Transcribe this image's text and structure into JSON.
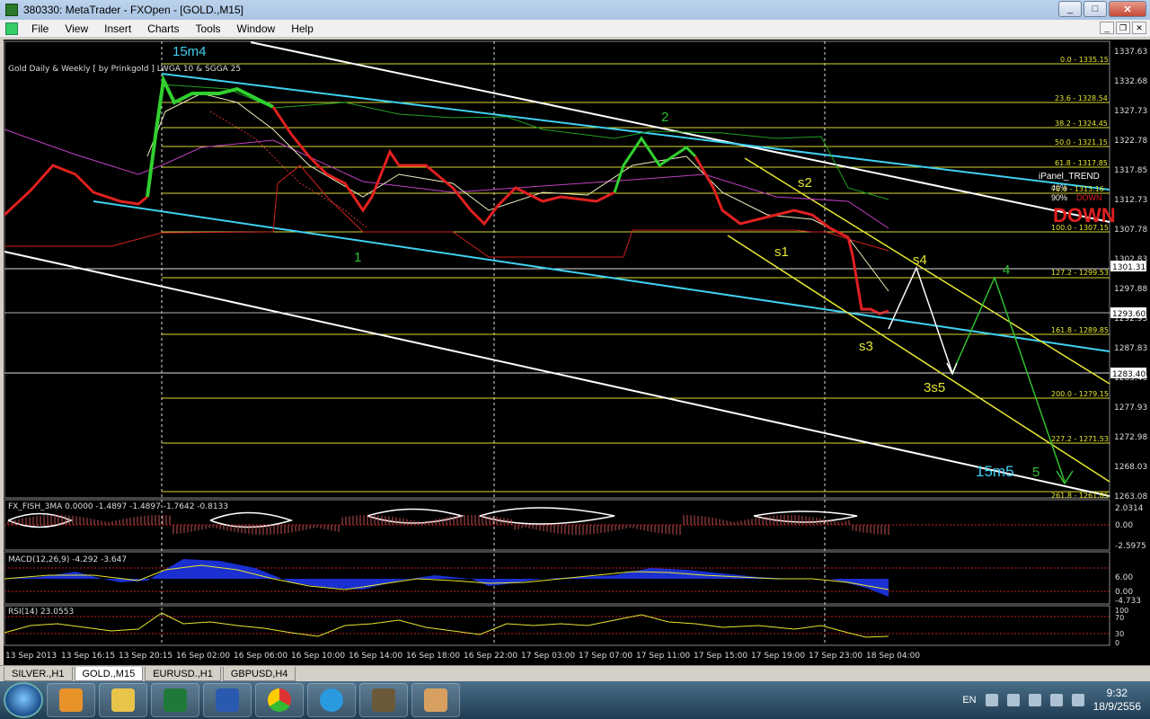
{
  "window": {
    "title": "380330: MetaTrader - FXOpen - [GOLD.,M15]",
    "win_minimize": "_",
    "win_maximize": "□",
    "win_close": "✕"
  },
  "menu": [
    "File",
    "View",
    "Insert",
    "Charts",
    "Tools",
    "Window",
    "Help"
  ],
  "chart": {
    "header": "Gold Daily & Weekly [ by Prinkgold ]  LWGA 10 &  SGGA 25",
    "price_scale": [
      "1337.63",
      "1332.68",
      "1327.73",
      "1322.78",
      "1317.85",
      "1312.73",
      "1307.78",
      "1302.83",
      "1297.88",
      "1292.93",
      "1287.83",
      "1283.40",
      "1277.93",
      "1272.98",
      "1268.03",
      "1263.08"
    ],
    "current_price": "1293.60",
    "tag_upper": "1301.31",
    "tag_lower": "1283.40",
    "fib_levels": [
      "0.0 - 1335.15",
      "23.6 - 1328.54",
      "38.2 - 1324.45",
      "50.0 - 1321.15",
      "61.8 - 1317.85",
      "78.6 - 1313.16",
      "100.0 - 1307.15",
      "127.2 - 1299.53",
      "161.8 - 1289.85",
      "200.0 - 1279.15",
      "227.2 - 1271.53",
      "261.8 - 1261.85"
    ],
    "wave_labels": {
      "w15m4": "15m4",
      "w1": "1",
      "w2": "2",
      "s1": "s1",
      "s2": "s2",
      "s3": "s3",
      "s4": "s4",
      "w3s5": "3s5",
      "w4": "4",
      "w15m5": "15m5",
      "w5": "5"
    },
    "ipanel": {
      "title": "iPanel_TREND",
      "label1": "40%",
      "label2": "90%",
      "label3": "DOWN",
      "signal": "DOWN"
    },
    "time_axis": [
      "13 Sep 2013",
      "13 Sep 16:15",
      "13 Sep 20:15",
      "16 Sep 02:00",
      "16 Sep 06:00",
      "16 Sep 10:00",
      "16 Sep 14:00",
      "16 Sep 18:00",
      "16 Sep 22:00",
      "17 Sep 03:00",
      "17 Sep 07:00",
      "17 Sep 11:00",
      "17 Sep 15:00",
      "17 Sep 19:00",
      "17 Sep 23:00",
      "18 Sep 04:00"
    ]
  },
  "indicators": {
    "fish": {
      "label": "FX_FISH_3MA 0.0000 -1.4897 -1.4897 -1.7642 -0.8133",
      "scale": [
        "2.0314",
        "0.00",
        "-2.5975"
      ]
    },
    "macd": {
      "label": "MACD(12,26,9) -4.292 -3.647",
      "scale": [
        "6.00",
        "0.00",
        "-4.733"
      ]
    },
    "rsi": {
      "label": "RSI(14) 23.0553",
      "scale": [
        "100",
        "70",
        "30",
        "0"
      ]
    }
  },
  "tabs": [
    "SILVER.,H1",
    "GOLD.,M15",
    "EURUSD.,H1",
    "GBPUSD,H4"
  ],
  "active_tab": "GOLD.,M15",
  "taskbar": {
    "apps": [
      "media-player",
      "file-explorer",
      "excel",
      "word",
      "chrome",
      "internet-explorer",
      "metatrader",
      "paint"
    ],
    "lang": "EN",
    "time": "9:32",
    "date": "18/9/2556"
  }
}
